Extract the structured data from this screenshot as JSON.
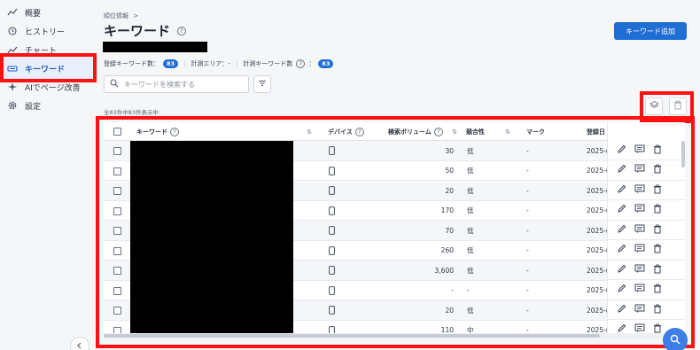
{
  "sidebar": {
    "items": [
      {
        "label": "概要",
        "icon": "trend-icon"
      },
      {
        "label": "ヒストリー",
        "icon": "history-icon"
      },
      {
        "label": "チャート",
        "icon": "chart-icon"
      },
      {
        "label": "キーワード",
        "icon": "keyword-icon"
      },
      {
        "label": "AIでページ改善",
        "icon": "sparkle-icon"
      },
      {
        "label": "設定",
        "icon": "gear-icon"
      }
    ],
    "active_index": 3
  },
  "header": {
    "breadcrumb": "順位情報",
    "breadcrumb_sep": ">",
    "title": "キーワード",
    "add_button": "キーワード追加"
  },
  "stats": {
    "registered_label": "登録キーワード数：",
    "registered_count": "83",
    "area_label": "計測エリア：-",
    "measured_label": "計測キーワード数",
    "measured_count": "83"
  },
  "search": {
    "placeholder": "キーワードを検索する"
  },
  "count_text": "全83件中83件表示中",
  "table": {
    "columns": {
      "keyword": "キーワード",
      "device": "デバイス",
      "volume": "検索ボリューム",
      "competition": "競合性",
      "mark": "マーク",
      "registered": "登録日"
    },
    "rows": [
      {
        "volume": "30",
        "competition": "低",
        "mark": "-",
        "date": "2025-("
      },
      {
        "volume": "50",
        "competition": "低",
        "mark": "-",
        "date": "2025-("
      },
      {
        "volume": "20",
        "competition": "低",
        "mark": "-",
        "date": "2025-("
      },
      {
        "volume": "170",
        "competition": "低",
        "mark": "-",
        "date": "2025-("
      },
      {
        "volume": "70",
        "competition": "低",
        "mark": "-",
        "date": "2025-("
      },
      {
        "volume": "260",
        "competition": "低",
        "mark": "-",
        "date": "2025-("
      },
      {
        "volume": "3,600",
        "competition": "低",
        "mark": "-",
        "date": "2025-("
      },
      {
        "volume": "-",
        "competition": "-",
        "mark": "-",
        "date": "2025-("
      },
      {
        "volume": "20",
        "competition": "低",
        "mark": "-",
        "date": "2025-("
      },
      {
        "volume": "110",
        "competition": "中",
        "mark": "-",
        "date": "2025-("
      }
    ]
  },
  "colors": {
    "accent": "#1f6ed4",
    "highlight": "#ff1111"
  }
}
